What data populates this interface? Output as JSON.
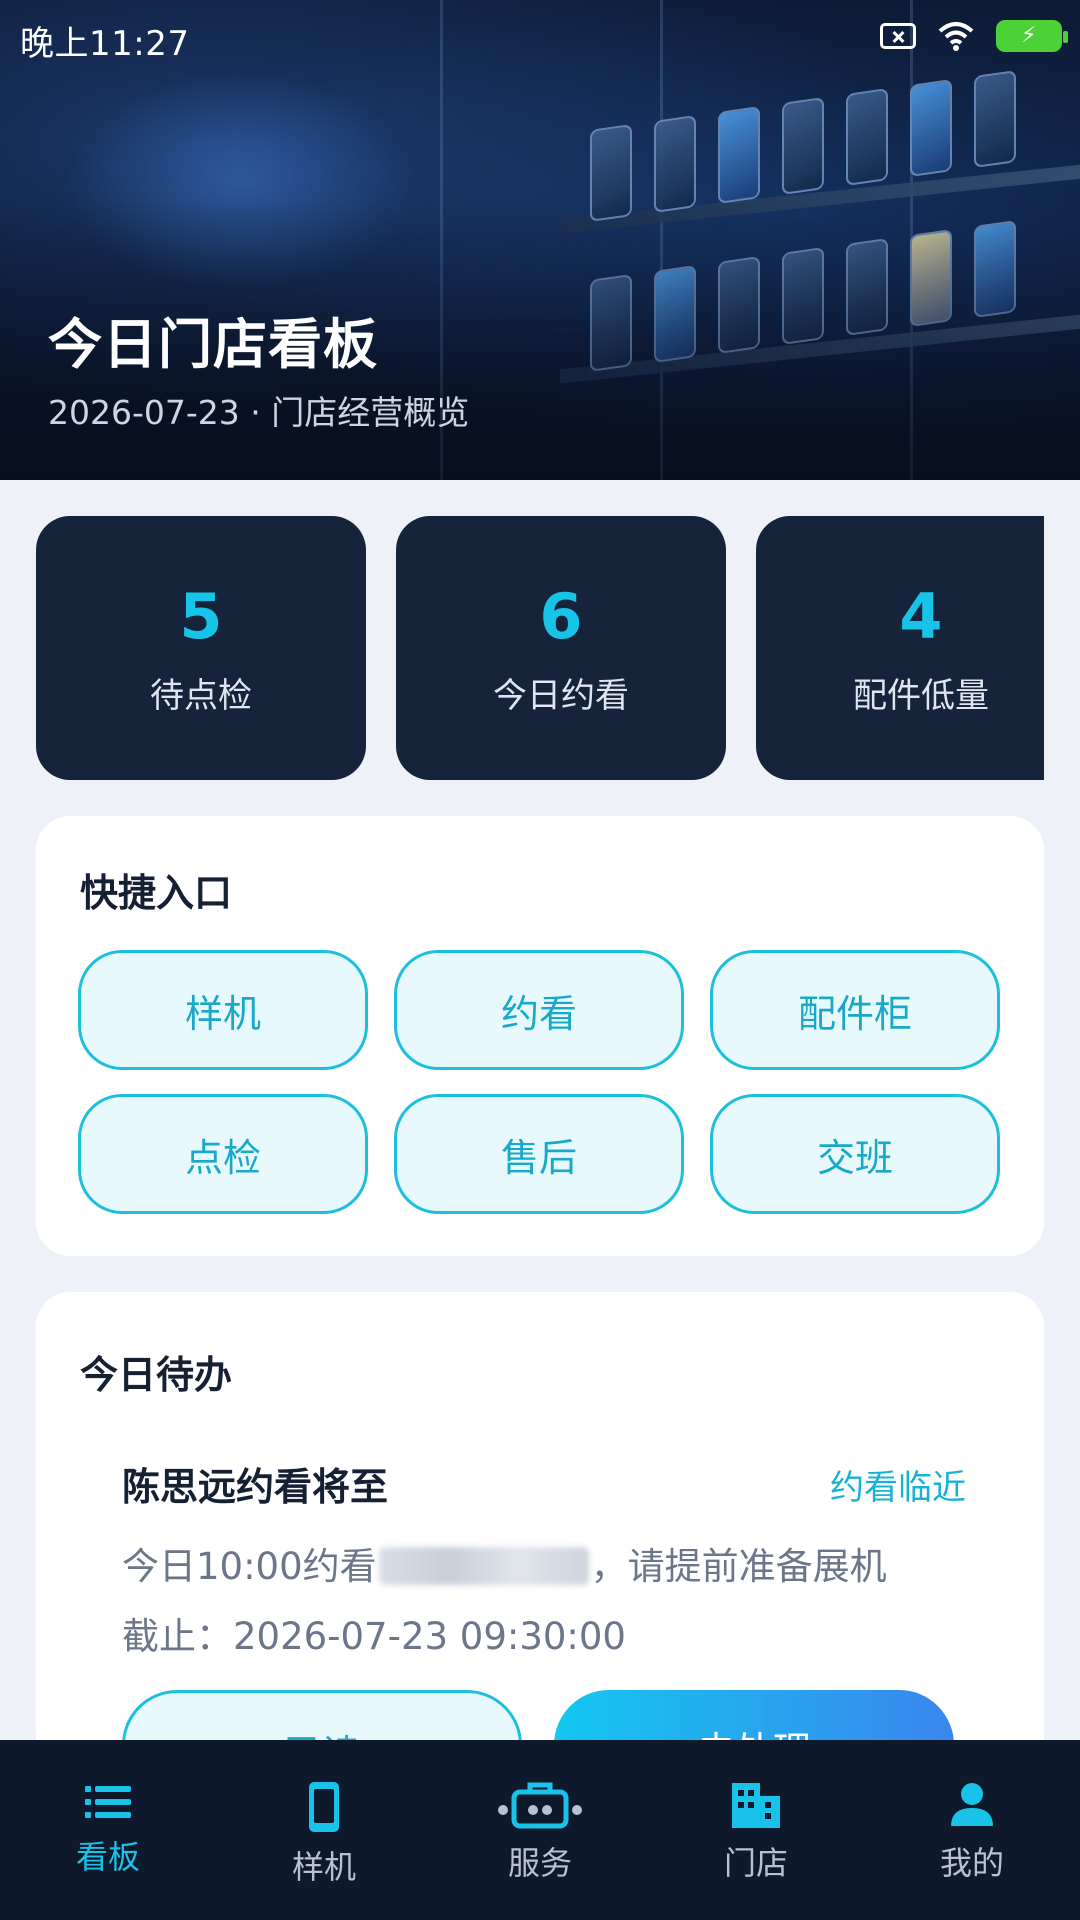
{
  "status_bar": {
    "time": "晚上11:27"
  },
  "hero": {
    "title": "今日门店看板",
    "subtitle": "2026-07-23 · 门店经营概览"
  },
  "stats": [
    {
      "value": "5",
      "label": "待点检"
    },
    {
      "value": "6",
      "label": "今日约看"
    },
    {
      "value": "4",
      "label": "配件低量"
    }
  ],
  "quick_entry": {
    "title": "快捷入口",
    "buttons": [
      "样机",
      "约看",
      "配件柜",
      "点检",
      "售后",
      "交班"
    ]
  },
  "todo": {
    "title": "今日待办",
    "item": {
      "title": "陈思远约看将至",
      "tag": "约看临近",
      "desc_prefix": "今日10:00约看",
      "desc_suffix": "，请提前准备展机",
      "deadline": "截止：2026-07-23 09:30:00",
      "read_label": "已读",
      "handle_label": "去处理"
    }
  },
  "tabs": [
    {
      "label": "看板",
      "icon": "list-icon",
      "active": true
    },
    {
      "label": "样机",
      "icon": "phone-icon",
      "active": false
    },
    {
      "label": "服务",
      "icon": "toolbox-icon",
      "active": false
    },
    {
      "label": "门店",
      "icon": "store-icon",
      "active": false
    },
    {
      "label": "我的",
      "icon": "user-icon",
      "active": false
    }
  ],
  "colors": {
    "accent": "#19c2e8",
    "stat_card_bg": "#15233b",
    "tabbar_bg": "#0e192c",
    "page_bg": "#eef2f8"
  }
}
